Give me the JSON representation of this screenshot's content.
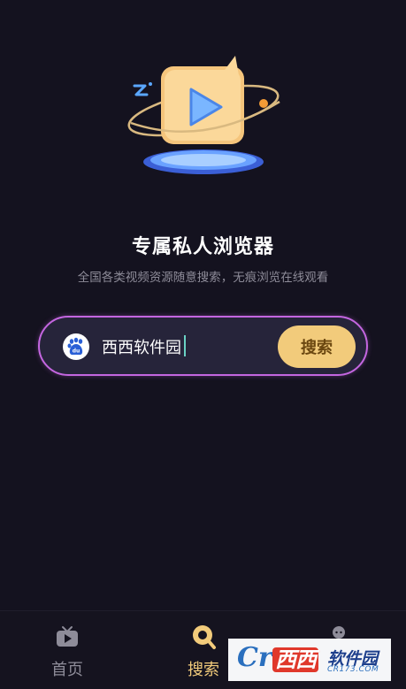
{
  "hero": {
    "title": "专属私人浏览器",
    "subtitle": "全国各类视频资源随意搜索，无痕浏览在线观看"
  },
  "search": {
    "engine_icon": "baidu-paw-icon",
    "engine_icon_text": "du",
    "query": "西西软件园",
    "button_label": "搜索"
  },
  "nav": {
    "items": [
      {
        "label": "首页",
        "icon": "tv-play-icon",
        "active": false
      },
      {
        "label": "搜索",
        "icon": "magnifier-icon",
        "active": true
      },
      {
        "label": "",
        "icon": "profile-icon",
        "active": false
      }
    ]
  },
  "watermark": {
    "logo": "Cr",
    "brand": "西西",
    "name": "软件园",
    "url": "CR173.COM"
  },
  "colors": {
    "background": "#14121f",
    "accent_gold": "#f2cb7b",
    "search_border": "#c466e0",
    "muted_text": "#8e8c99"
  }
}
